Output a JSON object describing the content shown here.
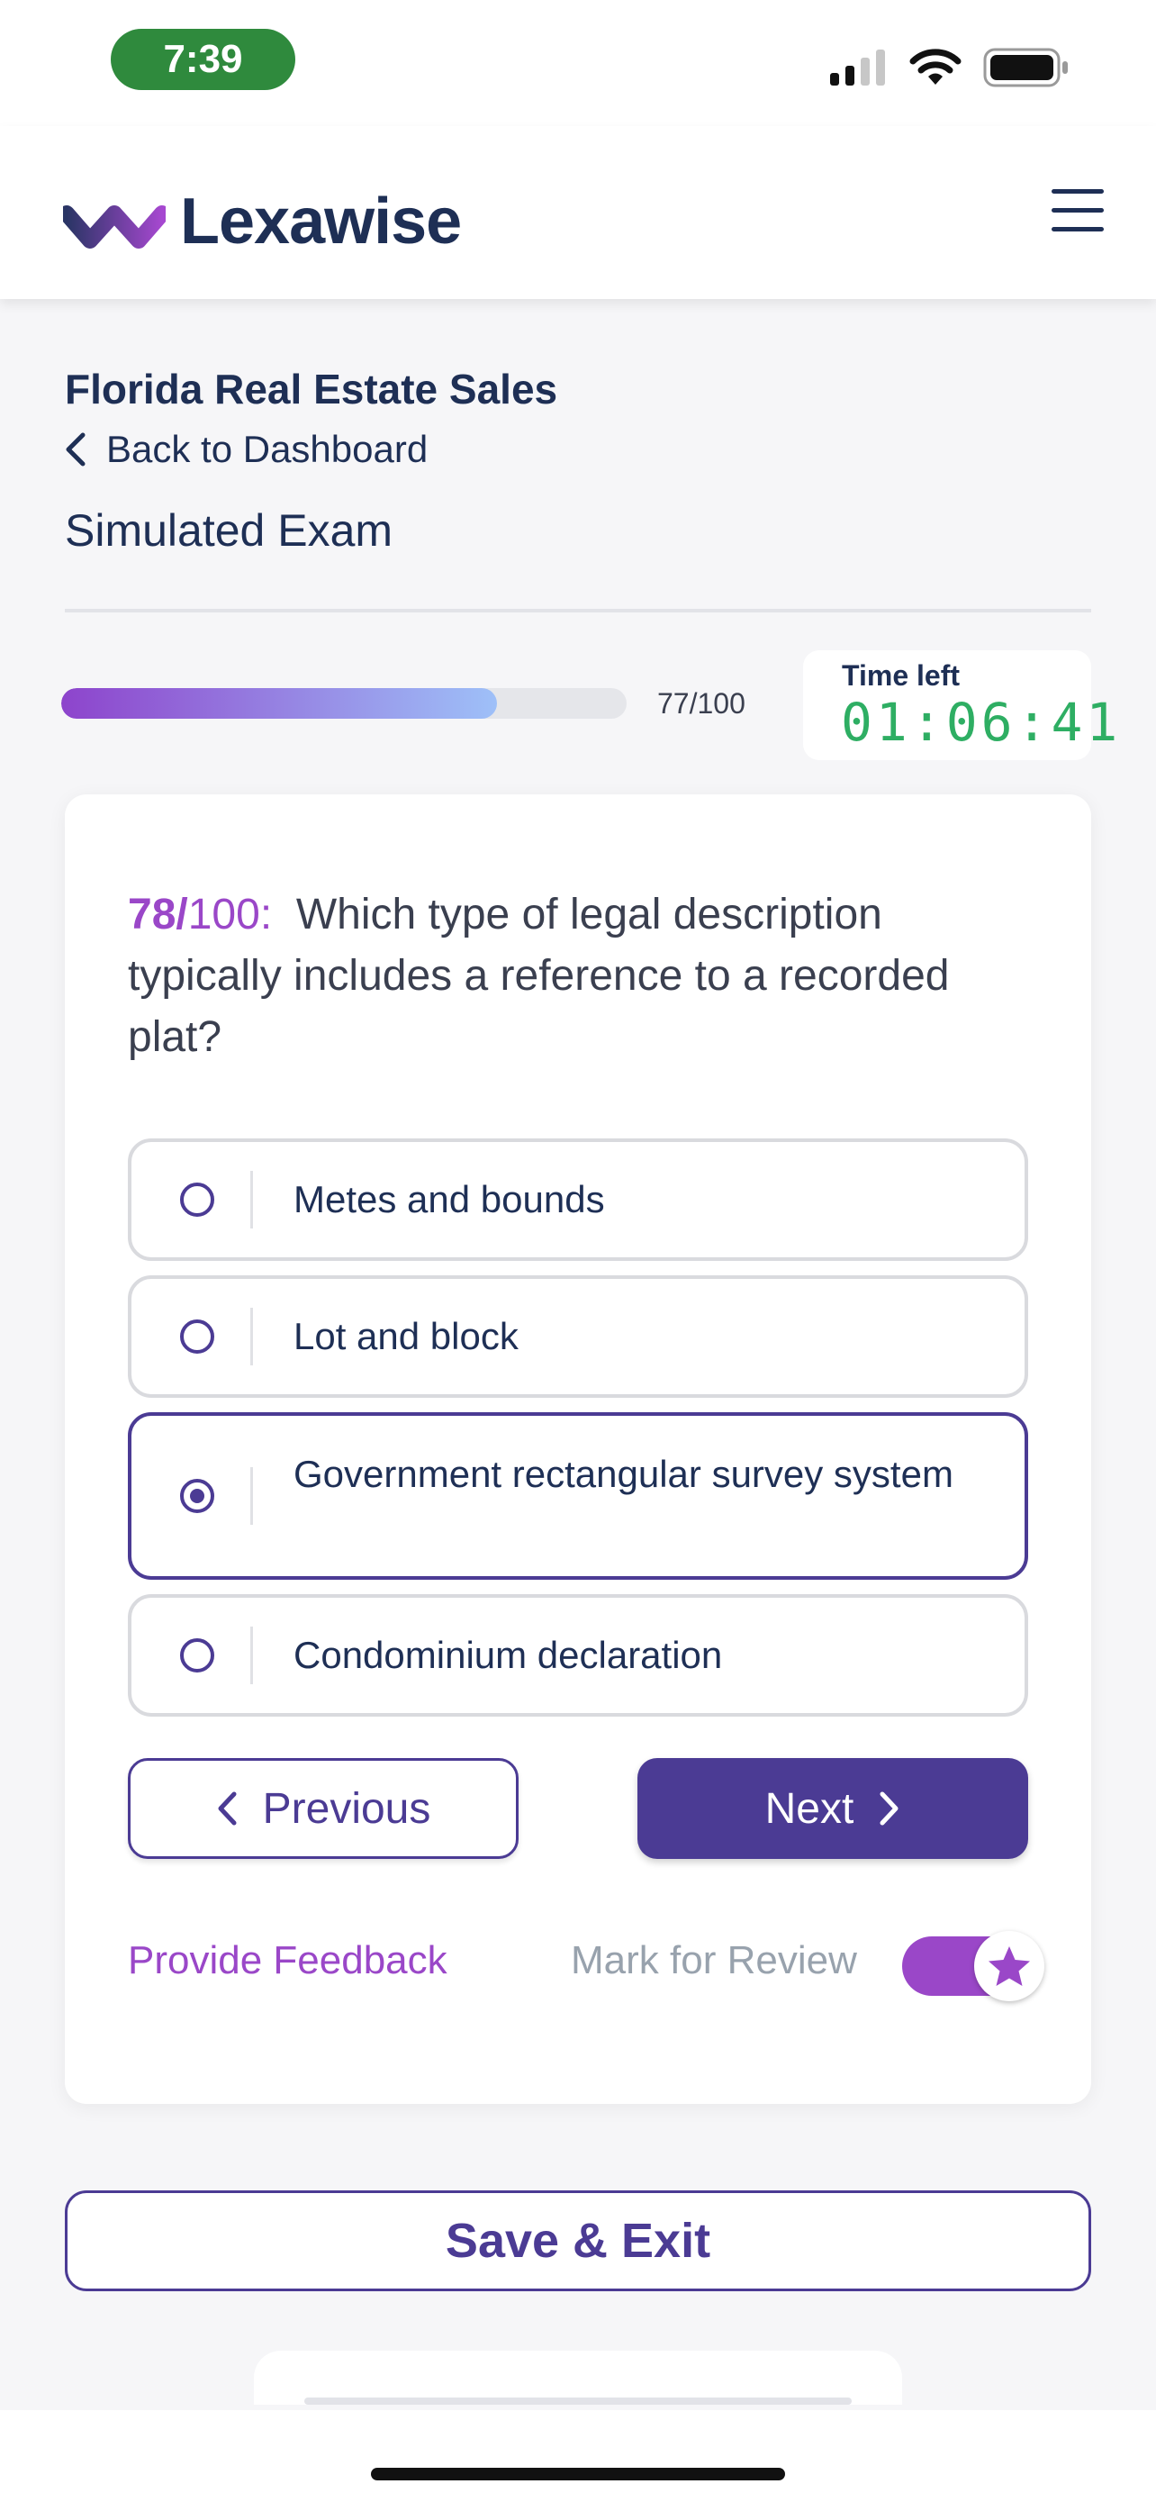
{
  "status_bar": {
    "time": "7:39",
    "icons": [
      "cellular-signal-icon",
      "wifi-icon",
      "battery-icon"
    ]
  },
  "header": {
    "brand": "Lexawise",
    "icons": [
      "lexawise-logo-mark",
      "hamburger-menu-icon"
    ]
  },
  "page": {
    "course_title": "Florida Real Estate Sales",
    "back_link": "Back to Dashboard",
    "exam_title": "Simulated Exam"
  },
  "progress": {
    "label": "77/100",
    "completed": 77,
    "total": 100
  },
  "timer": {
    "label": "Time left",
    "value": "01:06:41"
  },
  "question": {
    "number": "78/",
    "total": "100:",
    "text": "Which type of legal description typically includes a reference to a recorded plat?",
    "options": [
      {
        "label": "Metes and bounds",
        "selected": false
      },
      {
        "label": "Lot and block",
        "selected": false
      },
      {
        "label": "Government rectangular survey system",
        "selected": true
      },
      {
        "label": "Condominium declaration",
        "selected": false
      }
    ]
  },
  "navigation": {
    "previous_label": "Previous",
    "next_label": "Next"
  },
  "footer_actions": {
    "feedback_label": "Provide Feedback",
    "review_label": "Mark for Review",
    "review_toggle_on": true
  },
  "save_exit_label": "Save & Exit",
  "colors": {
    "brand_navy": "#1e2f55",
    "accent_purple": "#4b3b94",
    "highlight_purple": "#9a47c8",
    "timer_green": "#2eae63",
    "status_pill_green": "#2f8a3d"
  }
}
